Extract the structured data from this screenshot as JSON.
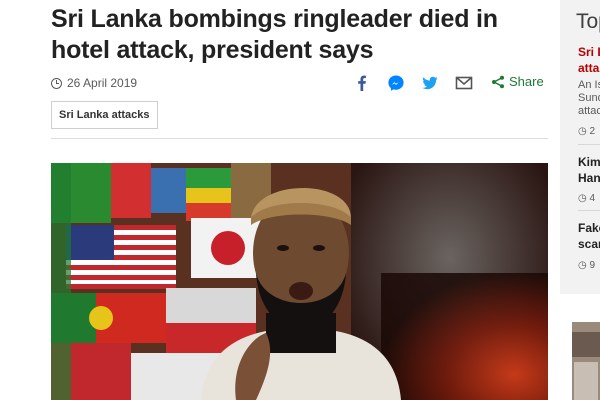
{
  "article": {
    "headline": "Sri Lanka bombings ringleader died in hotel attack, president says",
    "date": "26 April 2019",
    "tag": "Sri Lanka attacks",
    "share_label": "Share"
  },
  "share_icons": [
    "facebook-icon",
    "messenger-icon",
    "twitter-icon",
    "email-icon",
    "share-icon"
  ],
  "colors": {
    "facebook": "#3b5998",
    "messenger": "#0084ff",
    "twitter": "#1da1f2",
    "share_green": "#1d7a35",
    "sidebar_bg": "#f2f2f2",
    "link_red": "#b80000"
  },
  "sidebar": {
    "heading": "Top",
    "stories": [
      {
        "title_lines": [
          "Sri L",
          "atta"
        ],
        "summary_lines": [
          "An Is",
          "Sund",
          "attac"
        ],
        "meta": "2"
      },
      {
        "title_lines": [
          "Kim",
          "Han"
        ],
        "meta": "4"
      },
      {
        "title_lines": [
          "Fake",
          "scan"
        ],
        "meta": "9"
      }
    ]
  }
}
